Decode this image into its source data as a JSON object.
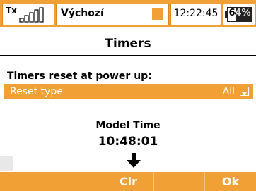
{
  "statusbar": {
    "tx_label": "Tx",
    "signal_icon": "signal-bars-icon",
    "model_name": "Výchozí",
    "time": "12:22:45",
    "battery_percent": "64%",
    "battery_level": 0.64,
    "accent_color": "#f0a034"
  },
  "page": {
    "title": "Timers"
  },
  "settings": {
    "section_label": "Timers reset at power up:",
    "reset_type_label": "Reset type",
    "reset_type_value": "All"
  },
  "model_time": {
    "label": "Model Time",
    "value": "10:48:01",
    "indicator_icon": "down-arrow-icon"
  },
  "softkeys": [
    {
      "label": ""
    },
    {
      "label": ""
    },
    {
      "label": "Clr"
    },
    {
      "label": ""
    },
    {
      "label": "Ok"
    }
  ]
}
